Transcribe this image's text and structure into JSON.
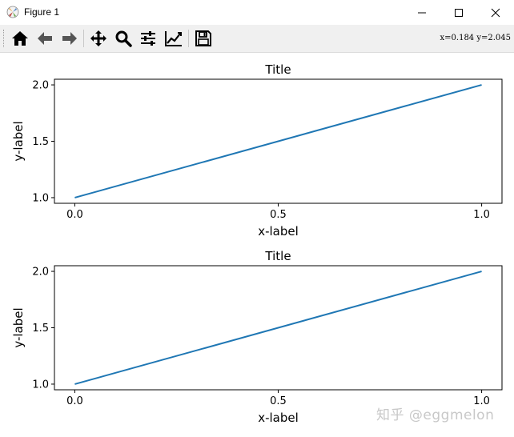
{
  "window": {
    "title": "Figure 1",
    "minimize_icon": "minimize-icon",
    "maximize_icon": "maximize-icon",
    "close_icon": "close-icon"
  },
  "toolbar": {
    "buttons": [
      {
        "name": "home-button",
        "icon": "home-icon"
      },
      {
        "name": "back-button",
        "icon": "back-arrow-icon"
      },
      {
        "name": "forward-button",
        "icon": "forward-arrow-icon"
      },
      {
        "name": "pan-button",
        "icon": "move-icon"
      },
      {
        "name": "zoom-button",
        "icon": "zoom-icon"
      },
      {
        "name": "subplots-button",
        "icon": "sliders-icon"
      },
      {
        "name": "axes-edit-button",
        "icon": "line-chart-icon"
      },
      {
        "name": "save-button",
        "icon": "save-icon"
      }
    ],
    "coords": "x=0.184  y=2.045"
  },
  "watermark": "知乎 @eggmelon",
  "chart_data": [
    {
      "type": "line",
      "title": "Title",
      "xlabel": "x-label",
      "ylabel": "y-label",
      "x": [
        0.0,
        1.0
      ],
      "series": [
        {
          "values": [
            1.0,
            2.0
          ],
          "color": "#1f77b4"
        }
      ],
      "xlim": [
        -0.05,
        1.05
      ],
      "ylim": [
        0.95,
        2.05
      ],
      "xticks": [
        "0.0",
        "0.5",
        "1.0"
      ],
      "yticks": [
        "1.0",
        "1.5",
        "2.0"
      ],
      "grid": false
    },
    {
      "type": "line",
      "title": "Title",
      "xlabel": "x-label",
      "ylabel": "y-label",
      "x": [
        0.0,
        1.0
      ],
      "series": [
        {
          "values": [
            1.0,
            2.0
          ],
          "color": "#1f77b4"
        }
      ],
      "xlim": [
        -0.05,
        1.05
      ],
      "ylim": [
        0.95,
        2.05
      ],
      "xticks": [
        "0.0",
        "0.5",
        "1.0"
      ],
      "yticks": [
        "1.0",
        "1.5",
        "2.0"
      ],
      "grid": false
    }
  ]
}
